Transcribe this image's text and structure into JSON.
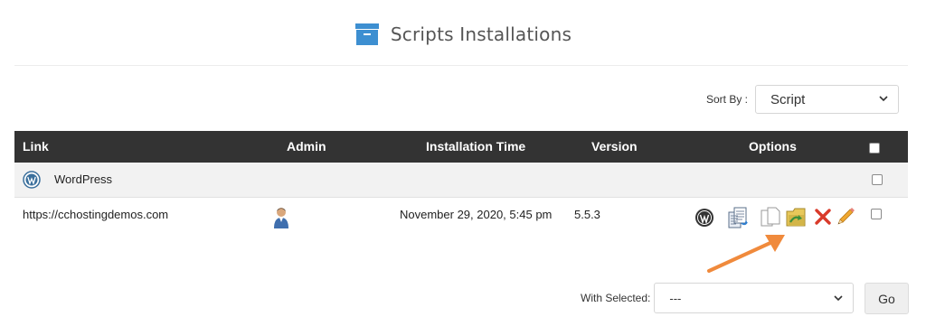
{
  "header": {
    "title": "Scripts Installations",
    "icon": "archive-box-icon",
    "icon_color": "#3d8fd1"
  },
  "sort": {
    "label": "Sort By :",
    "value": "Script"
  },
  "table": {
    "columns": [
      "Link",
      "Admin",
      "Installation Time",
      "Version",
      "Options"
    ],
    "group": {
      "name": "WordPress",
      "icon": "wordpress-logo-icon"
    },
    "rows": [
      {
        "link": "https://cchostingdemos.com",
        "admin_icon": "user-avatar-icon",
        "installation_time": "November 29, 2020, 5:45 pm",
        "version": "5.5.3",
        "options": [
          "wordpress-admin-icon",
          "backup-icon",
          "clone-icon",
          "migrate-icon",
          "remove-icon",
          "edit-icon"
        ]
      }
    ]
  },
  "bulk": {
    "label": "With Selected:",
    "value": "---",
    "go_label": "Go"
  },
  "colors": {
    "header_bg": "#333333",
    "arrow": "#f08a3c",
    "remove": "#d93a2a"
  }
}
